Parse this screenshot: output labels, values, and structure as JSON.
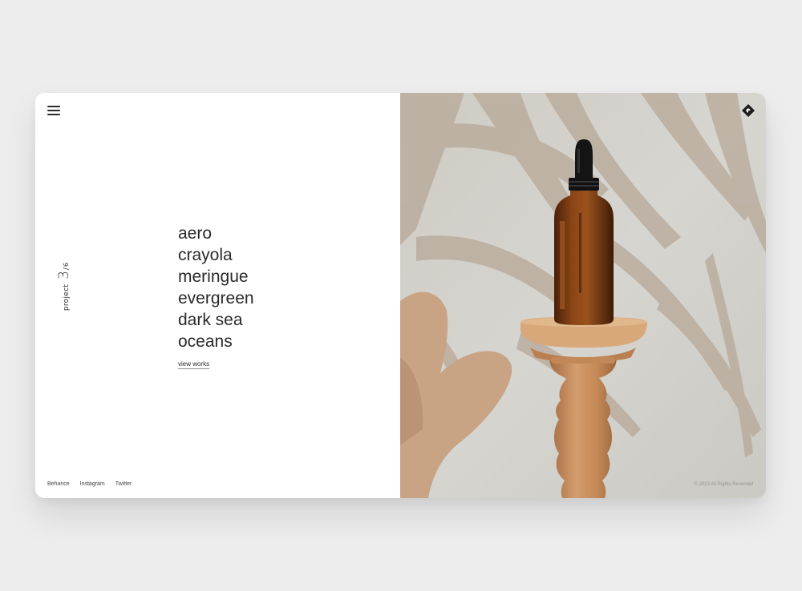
{
  "header": {
    "menu_icon": "hamburger-menu-icon",
    "logo_icon": "diamond-logo-icon"
  },
  "counter": {
    "label": "project",
    "current": "3",
    "separator": "/",
    "total": "6"
  },
  "projects": [
    "aero",
    "crayola",
    "meringue",
    "evergreen",
    "dark sea",
    "oceans"
  ],
  "cta": {
    "view_works": "view works"
  },
  "social": [
    "Behance",
    "Instagram",
    "Twitter"
  ],
  "footer": {
    "copyright": "© 2023 All Rights Reserved"
  },
  "colors": {
    "page_bg": "#ededee",
    "panel_bg": "#ffffff",
    "text": "#2a2a2a",
    "photo_bg": "#d2d1cc",
    "shadow": "#b7a898",
    "amber_bottle": "#6f3410",
    "wood": "#c79063"
  }
}
